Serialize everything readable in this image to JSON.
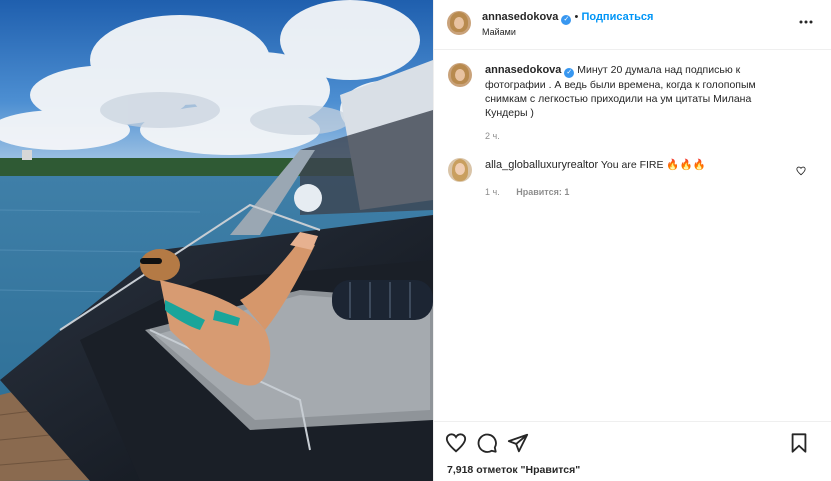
{
  "post": {
    "author": {
      "username": "annasedokova",
      "verified": true,
      "follow_label": "Подписаться",
      "location": "Майами"
    },
    "caption": {
      "username": "annasedokova",
      "text": "Минут 20 думала над подписью к фотографии . А ведь были времена, когда к голопопым снимкам с легкостью приходили на ум цитаты Милана Кундеры )",
      "time": "2 ч."
    },
    "comments": [
      {
        "username": "alla_globalluxuryrealtor",
        "text": "You are FIRE 🔥🔥🔥",
        "time": "1 ч.",
        "likes_label": "Нравится: 1"
      }
    ],
    "likes_text": "7,918 отметок \"Нравится\"",
    "icons": {
      "more": "more-options-icon",
      "like": "heart-icon",
      "comment": "comment-icon",
      "share": "paper-plane-icon",
      "save": "bookmark-icon"
    },
    "colors": {
      "accent": "#0095f6",
      "verified": "#3897f0",
      "text": "#262626",
      "muted": "#8e8e8e"
    }
  }
}
